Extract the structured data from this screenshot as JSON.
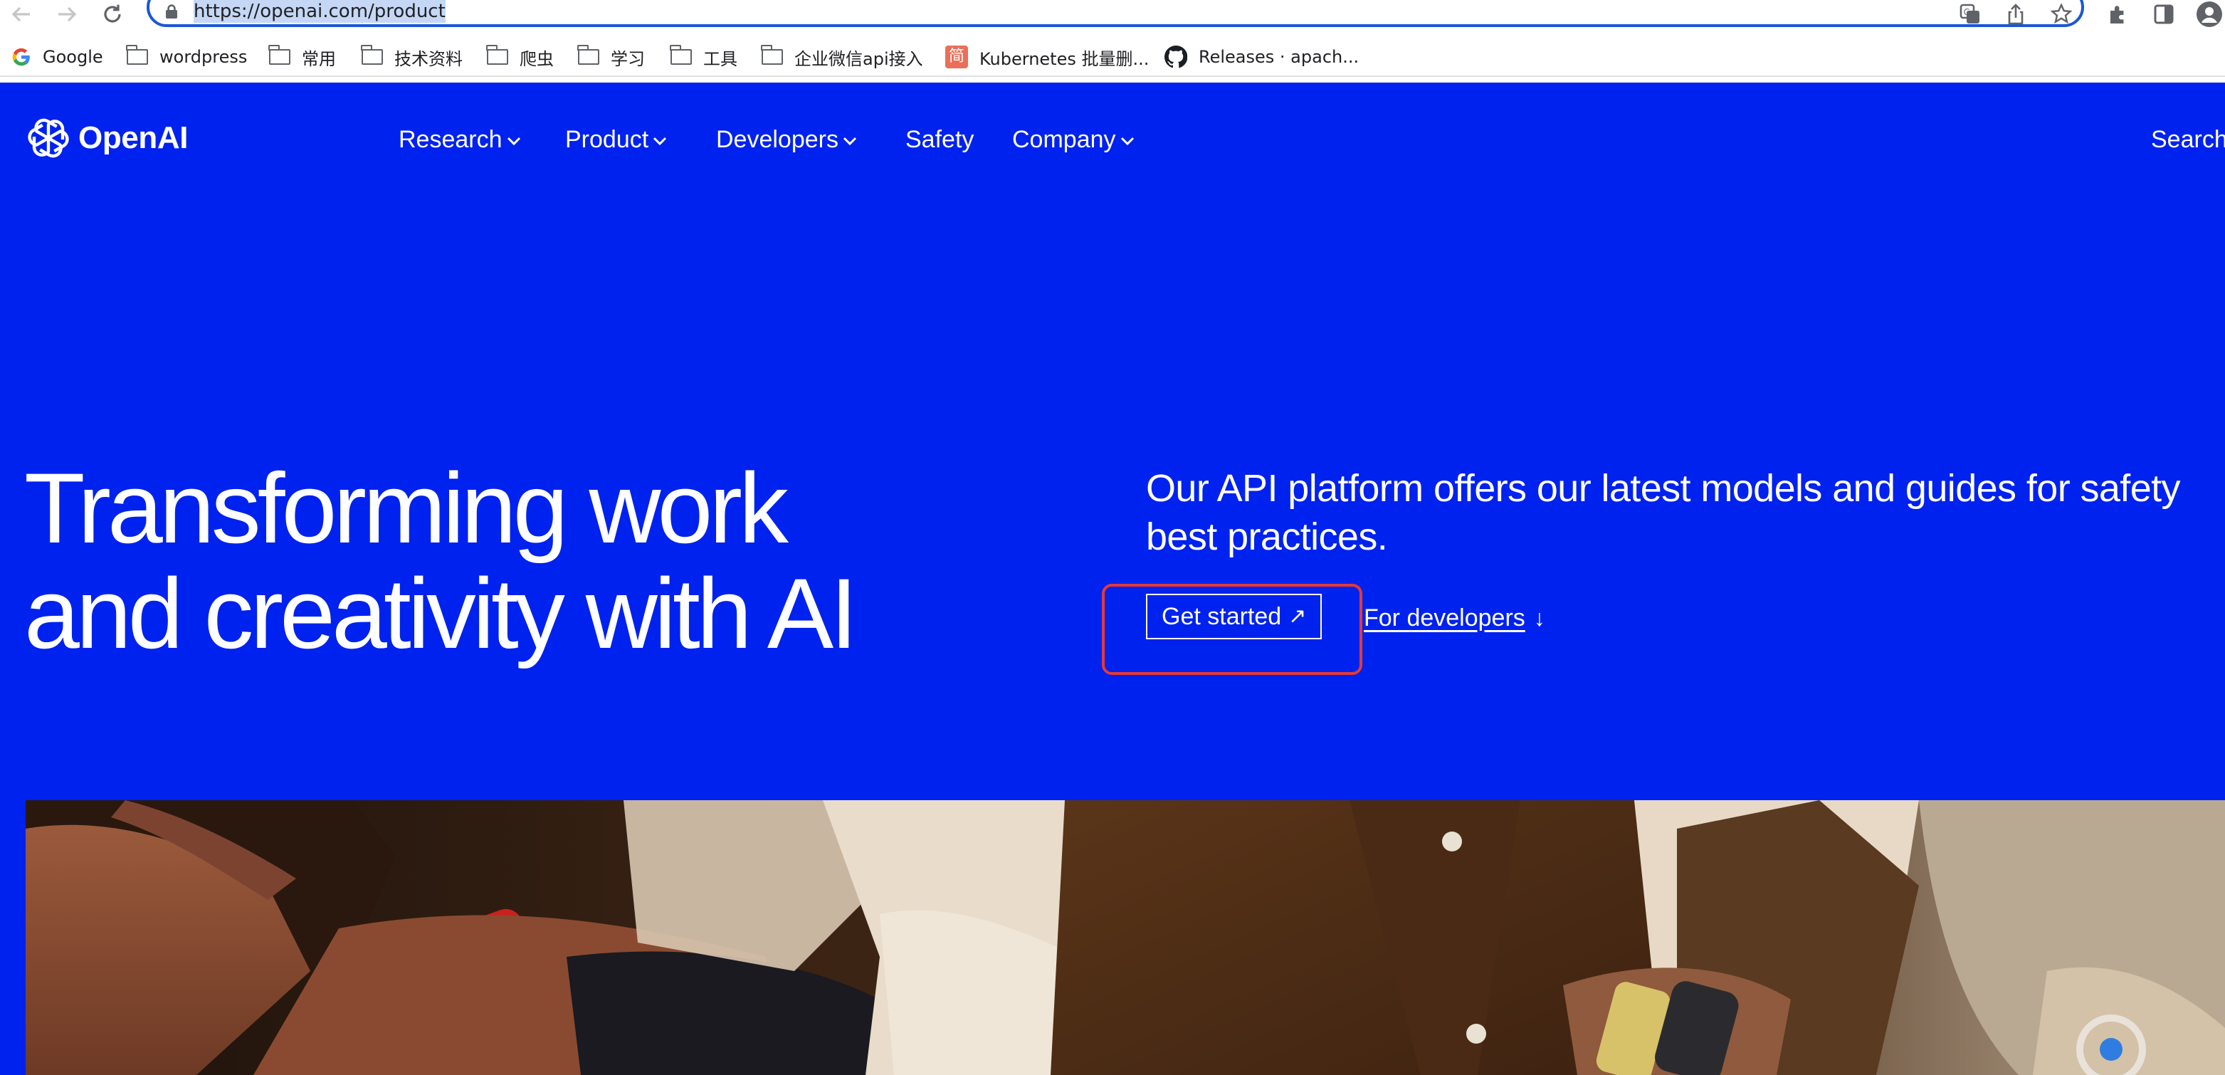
{
  "browser": {
    "url": "https://openai.com/product",
    "bookmarks": [
      {
        "label": "Google",
        "icon": "google-icon"
      },
      {
        "label": "wordpress",
        "icon": "folder-icon"
      },
      {
        "label": "常用",
        "icon": "folder-icon"
      },
      {
        "label": "技术资料",
        "icon": "folder-icon"
      },
      {
        "label": "爬虫",
        "icon": "folder-icon"
      },
      {
        "label": "学习",
        "icon": "folder-icon"
      },
      {
        "label": "工具",
        "icon": "folder-icon"
      },
      {
        "label": "企业微信api接入",
        "icon": "folder-icon"
      },
      {
        "label": "Kubernetes 批量删...",
        "icon": "jianshu-icon"
      },
      {
        "label": "Releases · apach...",
        "icon": "github-icon"
      }
    ],
    "jianshu_glyph": "简"
  },
  "site": {
    "logo_text": "OpenAI",
    "nav": [
      {
        "label": "Research",
        "has_menu": true
      },
      {
        "label": "Product",
        "has_menu": true
      },
      {
        "label": "Developers",
        "has_menu": true
      },
      {
        "label": "Safety",
        "has_menu": false
      },
      {
        "label": "Company",
        "has_menu": true
      }
    ],
    "search_label": "Search",
    "brand_color": "#0022ee"
  },
  "hero": {
    "title_line1": "Transforming work",
    "title_line2": "and creativity with AI",
    "subtitle": "Our API platform offers our latest models and guides for safety best practices.",
    "primary_cta": "Get started",
    "primary_cta_icon": "↗",
    "secondary_cta": "For developers",
    "secondary_cta_icon": "↓",
    "highlight_color": "#e53935"
  }
}
